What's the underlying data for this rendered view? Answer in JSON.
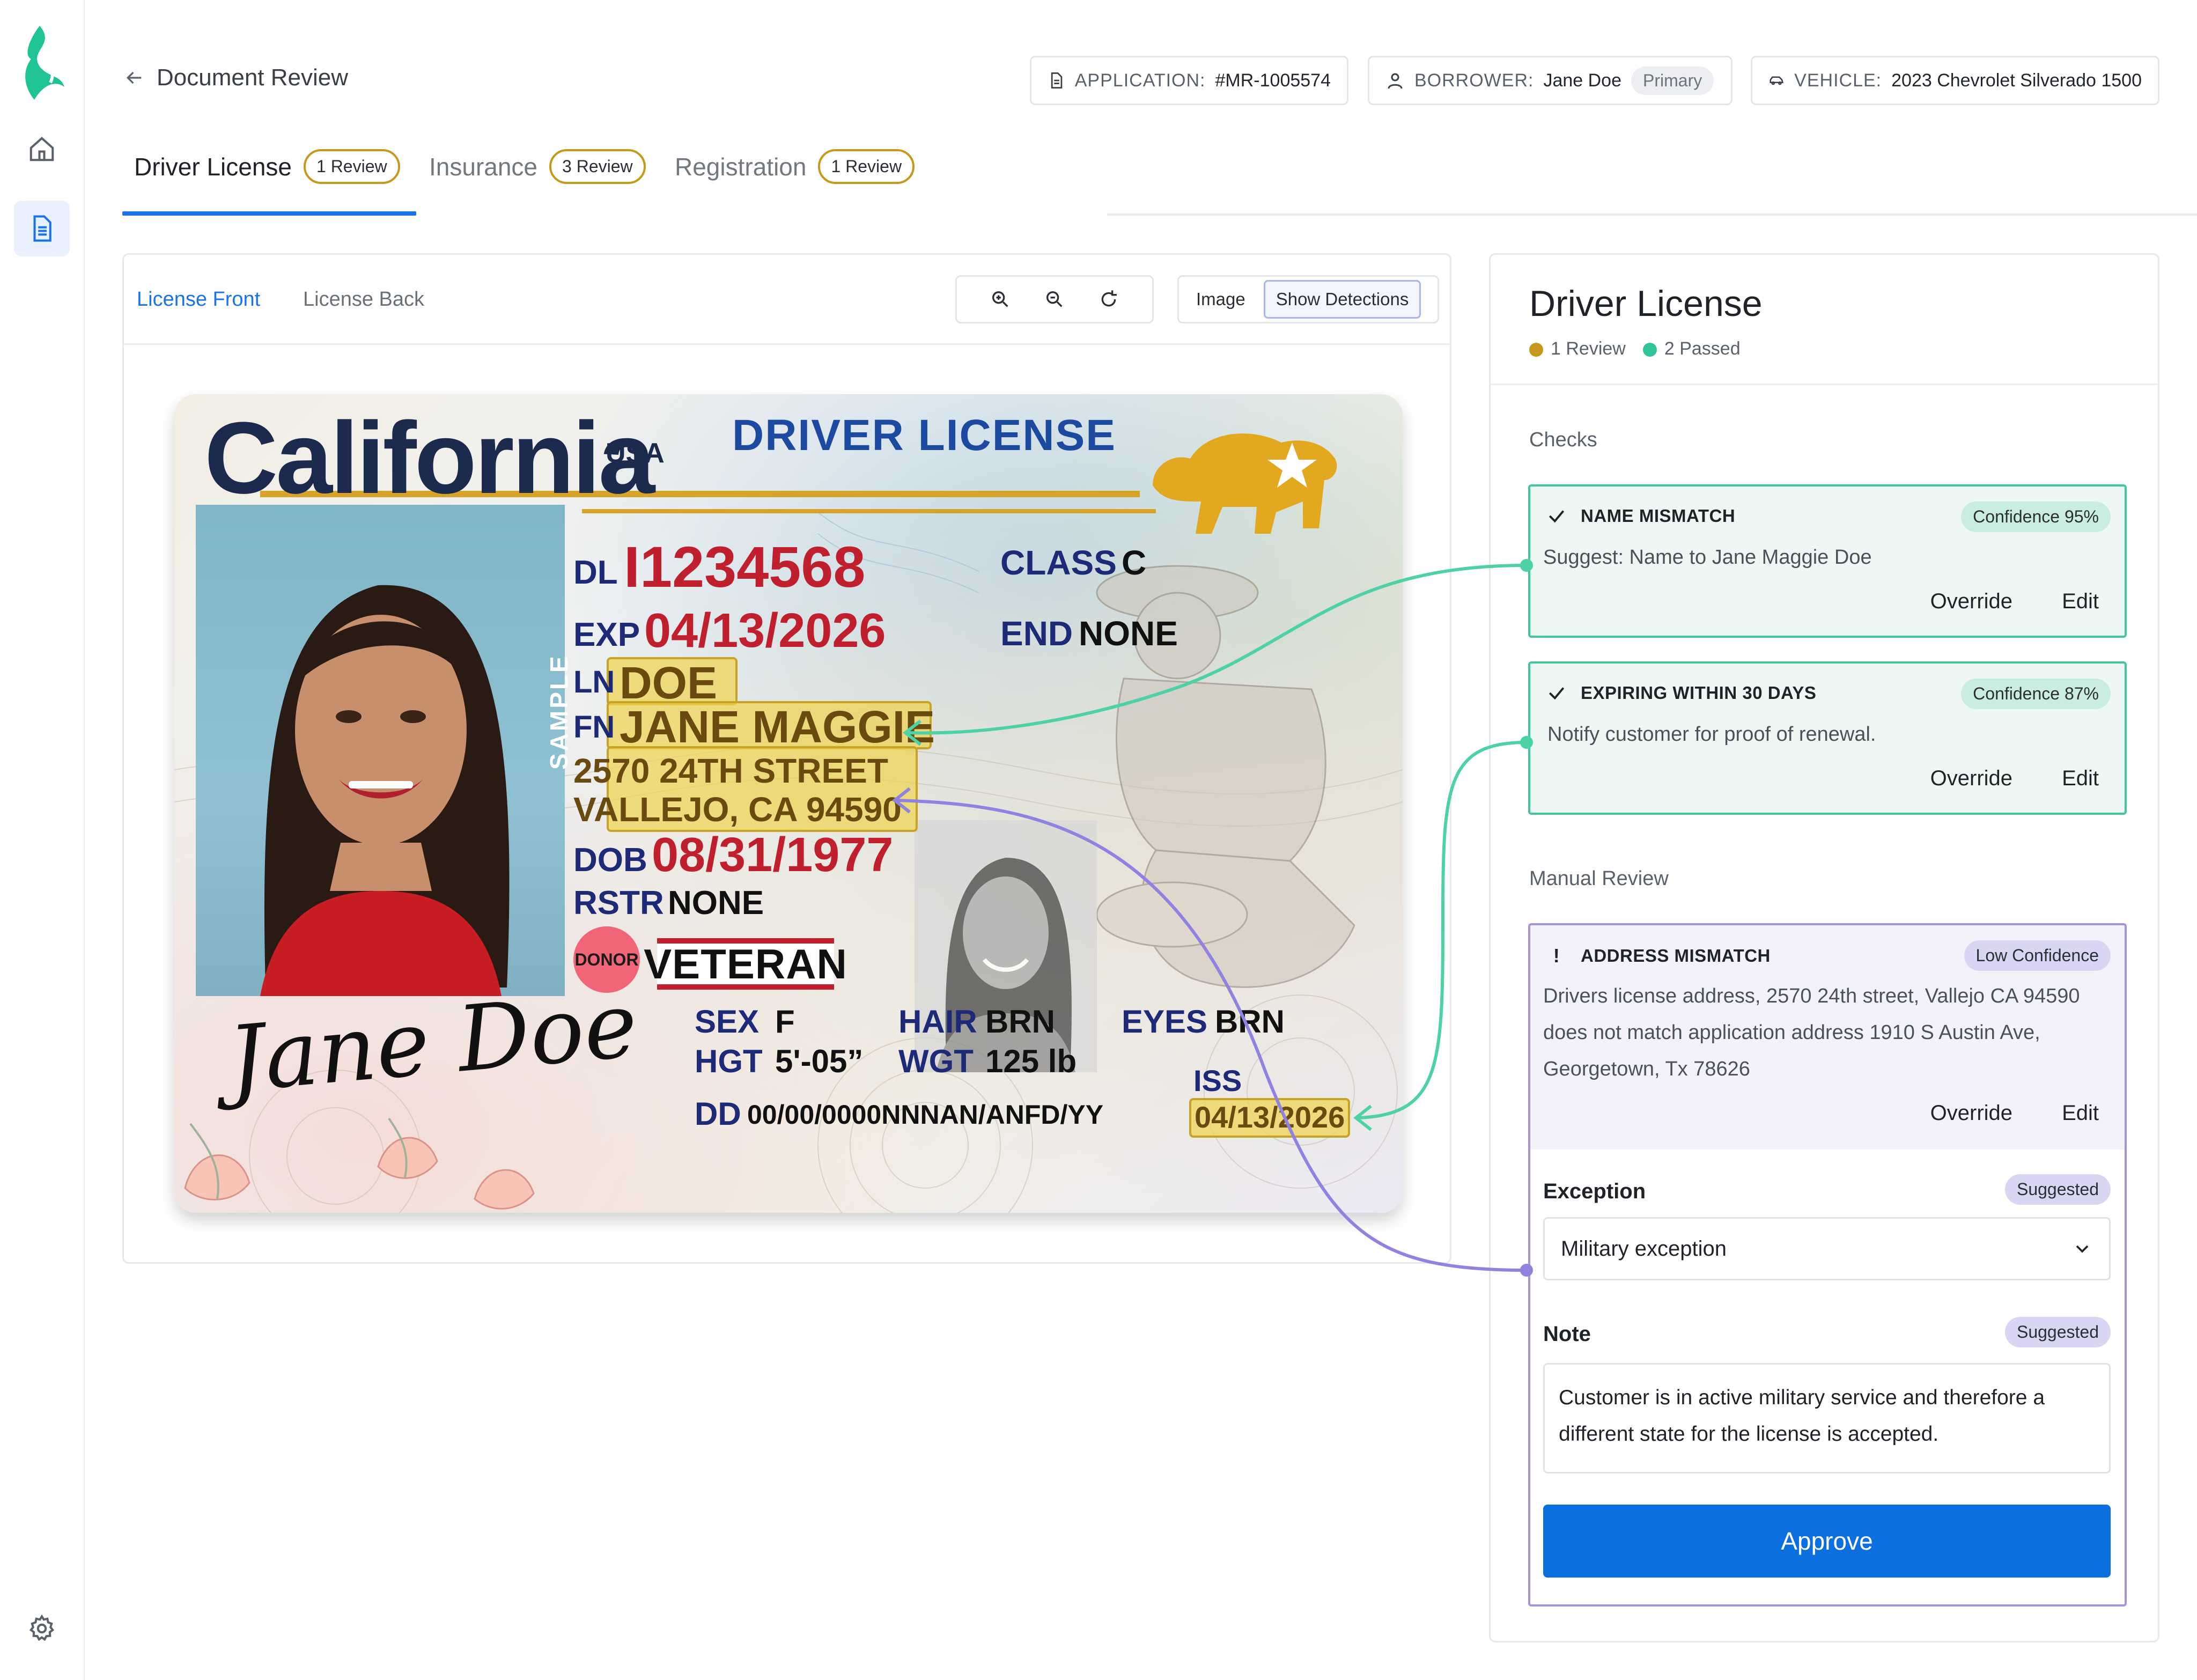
{
  "header": {
    "back_label": "Document Review",
    "application": {
      "key": "APPLICATION:",
      "value": "#MR-1005574"
    },
    "borrower": {
      "key": "BORROWER:",
      "value": "Jane Doe",
      "tag": "Primary"
    },
    "vehicle": {
      "key": "VEHICLE:",
      "value": "2023 Chevrolet Silverado 1500"
    }
  },
  "tabs": [
    {
      "label": "Driver License",
      "badge": "1 Review"
    },
    {
      "label": "Insurance",
      "badge": "3 Review"
    },
    {
      "label": "Registration",
      "badge": "1 Review"
    }
  ],
  "doc_viewer": {
    "sides": [
      "License Front",
      "License Back"
    ],
    "view_modes": [
      "Image",
      "Show Detections"
    ]
  },
  "license": {
    "state": "California",
    "country": "USA",
    "doc_title": "DRIVER LICENSE",
    "dl_label": "DL",
    "dl_number": "I1234568",
    "class_label": "CLASS",
    "class_value": "C",
    "exp_label": "EXP",
    "exp_value": "04/13/2026",
    "end_label": "END",
    "end_value": "NONE",
    "ln_label": "LN",
    "ln_value": "DOE",
    "fn_label": "FN",
    "fn_value": "JANE MAGGIE",
    "address_line1": "2570 24TH STREET",
    "address_line2": "VALLEJO, CA 94590",
    "dob_label": "DOB",
    "dob_value": "08/31/1977",
    "rstr_label": "RSTR",
    "rstr_value": "NONE",
    "donor": "DONOR",
    "veteran": "VETERAN",
    "sex_label": "SEX",
    "sex_value": "F",
    "hair_label": "HAIR",
    "hair_value": "BRN",
    "eyes_label": "EYES",
    "eyes_value": "BRN",
    "hgt_label": "HGT",
    "hgt_value": "5'-05”",
    "wgt_label": "WGT",
    "wgt_value": "125 lb",
    "iss_label": "ISS",
    "iss_value": "04/13/2026",
    "dd_label": "DD",
    "dd_value": "00/00/0000NNNAN/ANFD/YY",
    "sample": "SAMPLE",
    "signature": "Jane Doe"
  },
  "panel": {
    "title": "Driver License",
    "review_count": "1 Review",
    "passed_count": "2 Passed",
    "checks_label": "Checks",
    "manual_label": "Manual Review",
    "checks": [
      {
        "title": "NAME MISMATCH",
        "confidence": "Confidence 95%",
        "body": "Suggest: Name to Jane Maggie Doe",
        "override": "Override",
        "edit": "Edit"
      },
      {
        "title": "EXPIRING WITHIN 30 DAYS",
        "confidence": "Confidence 87%",
        "body": "Notify customer for proof of renewal.",
        "override": "Override",
        "edit": "Edit"
      }
    ],
    "manual": {
      "title": "ADDRESS MISMATCH",
      "confidence": "Low Confidence",
      "body": "Drivers license address, 2570 24th street, Vallejo CA 94590 does not match application address 1910 S Austin Ave, Georgetown, Tx 78626",
      "override": "Override",
      "edit": "Edit",
      "exception_label": "Exception",
      "exception_tag": "Suggested",
      "exception_value": "Military exception",
      "note_label": "Note",
      "note_tag": "Suggested",
      "note_value": "Customer is in active military service and therefore a different state for the license is accepted.",
      "approve": "Approve"
    }
  },
  "colors": {
    "accent": "#1a73e8",
    "review_gold": "#c59a1b",
    "pass_green": "#43c79e",
    "manual_purple": "#9d97de",
    "approve_blue": "#0b6fe0"
  }
}
